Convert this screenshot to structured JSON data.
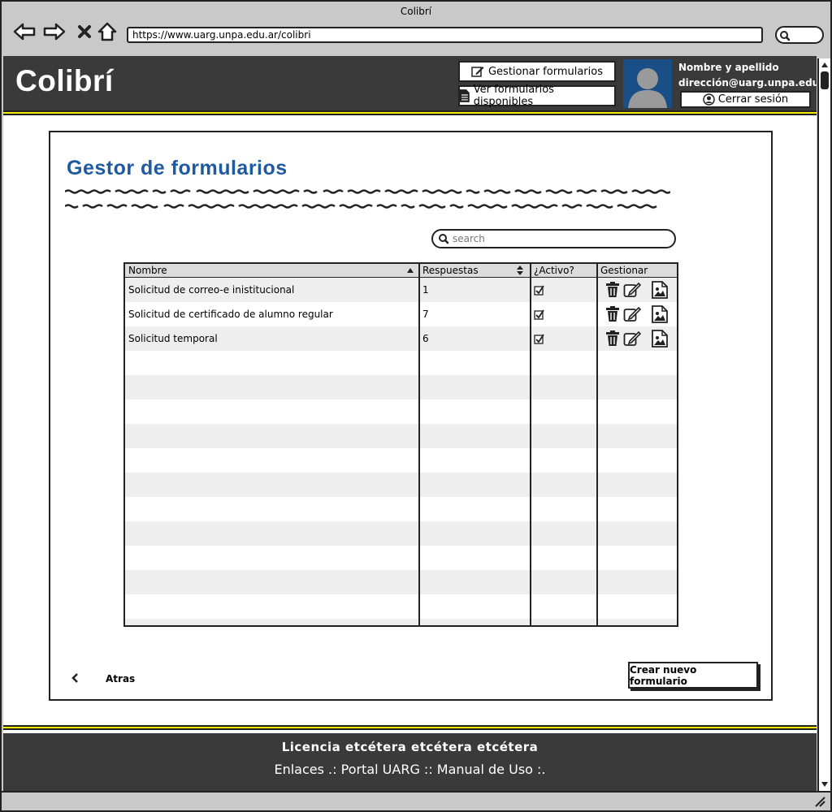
{
  "browser": {
    "window_title": "Colibrí",
    "url": "https://www.uarg.unpa.edu.ar/colibri"
  },
  "header": {
    "brand": "Colibrí",
    "btn_manage": "Gestionar formularios",
    "btn_view": "Ver formularios disponibles",
    "user_name": "Nombre y apellido",
    "user_email": "dirección@uarg.unpa.edu.ar",
    "logout": "Cerrar sesión"
  },
  "main": {
    "title": "Gestor de formularios",
    "search_placeholder": "search",
    "columns": {
      "name": "Nombre",
      "responses": "Respuestas",
      "active": "¿Activo?",
      "manage": "Gestionar"
    },
    "rows": [
      {
        "name": "Solicitud de correo-e inistitucional",
        "responses": "1",
        "active": true
      },
      {
        "name": "Solicitud de certificado de alumno regular",
        "responses": "7",
        "active": true
      },
      {
        "name": "Solicitud temporal",
        "responses": "6",
        "active": true
      }
    ],
    "back_label": "Atras",
    "create_label": "Crear nuevo formulario"
  },
  "footer": {
    "line1": "Licencia etcétera etcétera etcétera",
    "line2": "Enlaces .: Portal UARG :: Manual de Uso :."
  },
  "colors": {
    "header_bg": "#3a3a3a",
    "accent_yellow": "#f5ea00",
    "title_blue": "#1f5aa0",
    "avatar_bg": "#1a4e86"
  }
}
